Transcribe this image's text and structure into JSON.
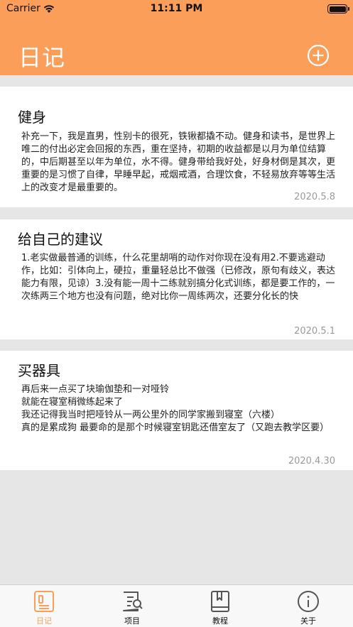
{
  "status_bar": {
    "carrier": "Carrier",
    "time": "11:11 PM"
  },
  "header": {
    "title": "日记",
    "add_icon": "plus-circle-icon",
    "background_color": "#fb9e5a"
  },
  "entries": [
    {
      "title": "健身",
      "body": "补充一下，我是直男，性别卡的很死，铁锹都撬不动。健身和读书，是世界上唯二的付出必定会回报的东西，重在坚持，初期的收益都是以月为单位结算的，中后期甚至以年为单位，水不得。健身带给我好处，好身材倒是其次，更重要的是习惯了自律，早睡早起，戒烟戒酒，合理饮食，不轻易放弃等等生活上的改变才是最重要的。",
      "date": "2020.5.8"
    },
    {
      "title": "给自己的建议",
      "body": "1.老实做最普通的训练，什么花里胡哨的动作对你现在没有用2.不要逃避动作，比如：引体向上，硬拉，重量轻总比不做强（已修改，原句有歧义，表达能力有限，见谅）3.没有能一周十二练就别搞分化式训练，都是要工作的，一次练两三个地方也没有问题，绝对比你一周练两次，还要分化长的快",
      "date": "2020.5.1"
    },
    {
      "title": "买器具",
      "body": "再后来一点买了块瑜伽垫和一对哑铃\n就能在寝室稍微练起来了\n我还记得我当时把哑铃从一两公里外的同学家搬到寝室（六楼）\n真的是累成狗 最要命的是那个时候寝室钥匙还借室友了（又跑去教学区要）",
      "date": "2020.4.30"
    }
  ],
  "tabbar": {
    "tabs": [
      {
        "label": "日记",
        "icon": "diary-icon",
        "active": true
      },
      {
        "label": "项目",
        "icon": "project-icon",
        "active": false
      },
      {
        "label": "教程",
        "icon": "book-icon",
        "active": false
      },
      {
        "label": "关于",
        "icon": "info-icon",
        "active": false
      }
    ],
    "active_color": "#fb9e5a"
  }
}
